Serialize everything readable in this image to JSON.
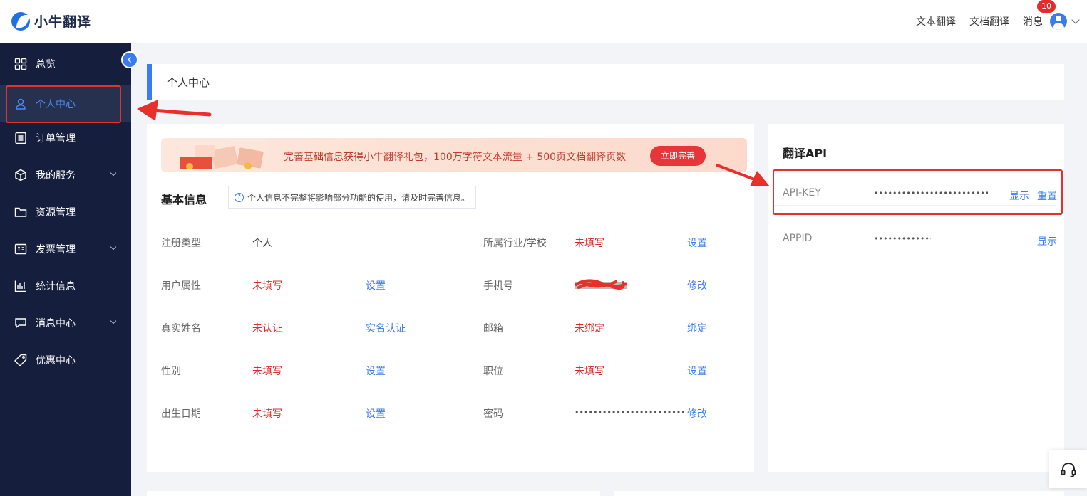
{
  "brand": {
    "name": "小牛翻译"
  },
  "topnav": {
    "text_translate": "文本翻译",
    "doc_translate": "文档翻译",
    "messages": "消息",
    "message_count": "10"
  },
  "sidebar": {
    "items": [
      {
        "label": "总览",
        "icon": "grid-icon"
      },
      {
        "label": "个人中心",
        "icon": "user-icon",
        "active": true
      },
      {
        "label": "订单管理",
        "icon": "list-icon"
      },
      {
        "label": "我的服务",
        "icon": "cube-icon",
        "expandable": true
      },
      {
        "label": "资源管理",
        "icon": "folder-icon"
      },
      {
        "label": "发票管理",
        "icon": "invoice-icon",
        "expandable": true
      },
      {
        "label": "统计信息",
        "icon": "chart-icon"
      },
      {
        "label": "消息中心",
        "icon": "message-icon",
        "expandable": true
      },
      {
        "label": "优惠中心",
        "icon": "tag-icon"
      }
    ]
  },
  "page": {
    "title": "个人中心"
  },
  "banner": {
    "text": "完善基础信息获得小牛翻译礼包，100万字符文本流量 + 500页文档翻译页数",
    "button": "立即完善"
  },
  "basic": {
    "title": "基本信息",
    "tip": "个人信息不完整将影响部分功能的使用，请及时完善信息。",
    "left_rows": [
      {
        "label": "注册类型",
        "value": "个人",
        "action": ""
      },
      {
        "label": "用户属性",
        "value": "未填写",
        "action": "设置"
      },
      {
        "label": "真实姓名",
        "value": "未认证",
        "action": "实名认证"
      },
      {
        "label": "性别",
        "value": "未填写",
        "action": "设置"
      },
      {
        "label": "出生日期",
        "value": "未填写",
        "action": "设置"
      }
    ],
    "right_rows": [
      {
        "label": "所属行业/学校",
        "value": "未填写",
        "action": "设置"
      },
      {
        "label": "手机号",
        "value": "",
        "action": "修改"
      },
      {
        "label": "邮箱",
        "value": "未绑定",
        "action": "绑定"
      },
      {
        "label": "职位",
        "value": "未填写",
        "action": "设置"
      },
      {
        "label": "密码",
        "value": "••••••••••••••••••••••••••••••••",
        "action": "修改"
      }
    ]
  },
  "api": {
    "title": "翻译API",
    "rows": [
      {
        "label": "API-KEY",
        "value": "••••••••••••••••••••••••••••••••",
        "show": "显示",
        "reset": "重置"
      },
      {
        "label": "APPID",
        "value": "••••••••••••••••",
        "show": "显示"
      }
    ]
  },
  "colors": {
    "sidebar_bg": "#161e3d",
    "accent": "#3a7cf0",
    "alert": "#e02a2a",
    "annotation": "#e8302a"
  }
}
